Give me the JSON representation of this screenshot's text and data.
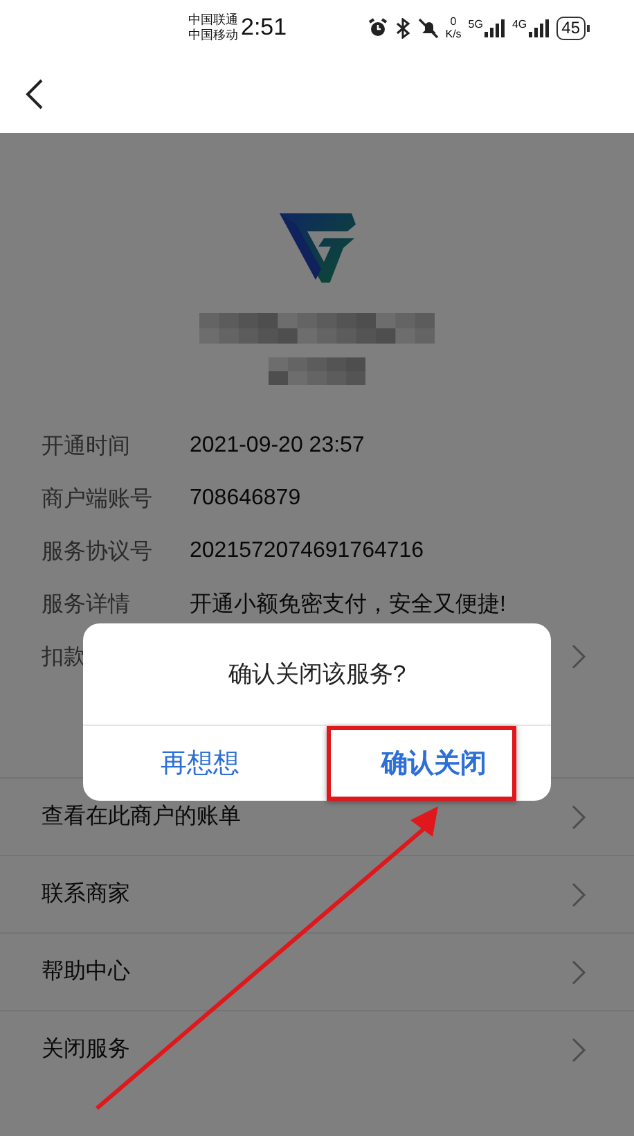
{
  "status_bar": {
    "carriers": [
      "中国联通",
      "中国移动"
    ],
    "time": "2:51",
    "net_speed_value": "0",
    "net_speed_unit": "K/s",
    "signals": [
      {
        "label": "5G"
      },
      {
        "label": "4G"
      }
    ],
    "battery": "45"
  },
  "details": [
    {
      "kind": "info",
      "label": "开通时间",
      "value": "2021-09-20 23:57"
    },
    {
      "kind": "info",
      "label": "商户端账号",
      "value": "708646879"
    },
    {
      "kind": "info",
      "label": "服务协议号",
      "value": "2021572074691764716"
    },
    {
      "kind": "info",
      "label": "服务详情",
      "value": "开通小额免密支付，安全又便捷!"
    },
    {
      "kind": "link",
      "label": "扣款"
    }
  ],
  "menu": [
    {
      "label": "查看在此商户的账单"
    },
    {
      "label": "联系商家"
    },
    {
      "label": "帮助中心"
    },
    {
      "label": "关闭服务"
    }
  ],
  "dialog": {
    "message": "确认关闭该服务?",
    "buttons": [
      {
        "label": "再想想",
        "primary": false,
        "highlighted": false
      },
      {
        "label": "确认关闭",
        "primary": true,
        "highlighted": true
      }
    ]
  }
}
